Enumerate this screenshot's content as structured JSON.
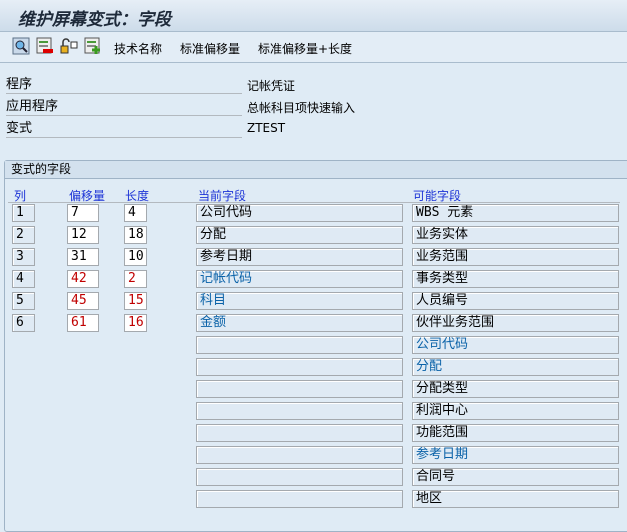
{
  "title": "维护屏幕变式：字段",
  "toolbar": {
    "icons": [
      "detail-icon",
      "delete-icon",
      "lock-icon",
      "add-icon"
    ],
    "buttons": [
      "技术名称",
      "标准偏移量",
      "标准偏移量+长度"
    ]
  },
  "info": [
    {
      "label": "程序",
      "value": "记帐凭证"
    },
    {
      "label": "应用程序",
      "value": "总帐科目项快速输入"
    },
    {
      "label": "变式",
      "value": "ZTEST"
    }
  ],
  "group": {
    "title": "变式的字段",
    "headers": {
      "col": "列",
      "offset": "偏移量",
      "length": "长度",
      "current": "当前字段",
      "possible": "可能字段"
    }
  },
  "rows": [
    {
      "col": "1",
      "offset": "7",
      "length": "4",
      "current": "公司代码",
      "red": false
    },
    {
      "col": "2",
      "offset": "12",
      "length": "18",
      "current": "分配",
      "red": false
    },
    {
      "col": "3",
      "offset": "31",
      "length": "10",
      "current": "参考日期",
      "red": false
    },
    {
      "col": "4",
      "offset": "42",
      "length": "2",
      "current": "记帐代码",
      "red": true
    },
    {
      "col": "5",
      "offset": "45",
      "length": "15",
      "current": "科目",
      "red": true
    },
    {
      "col": "6",
      "offset": "61",
      "length": "16",
      "current": "金额",
      "red": true
    }
  ],
  "possible": [
    {
      "text": "WBS 元素",
      "used": false
    },
    {
      "text": "业务实体",
      "used": false
    },
    {
      "text": "业务范围",
      "used": false
    },
    {
      "text": "事务类型",
      "used": false
    },
    {
      "text": "人员编号",
      "used": false
    },
    {
      "text": "伙伴业务范围",
      "used": false
    },
    {
      "text": "公司代码",
      "used": true
    },
    {
      "text": "分配",
      "used": true
    },
    {
      "text": "分配类型",
      "used": false
    },
    {
      "text": "利润中心",
      "used": false
    },
    {
      "text": "功能范围",
      "used": false
    },
    {
      "text": "参考日期",
      "used": true
    },
    {
      "text": "合同号",
      "used": false
    },
    {
      "text": "地区",
      "used": false
    }
  ]
}
